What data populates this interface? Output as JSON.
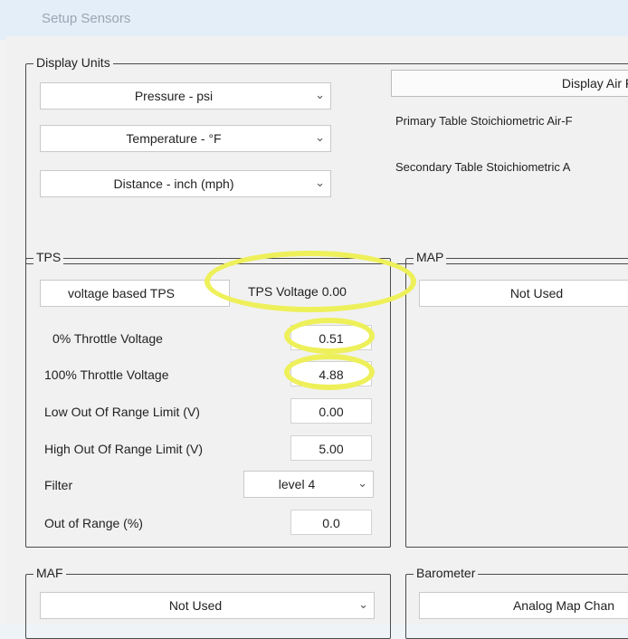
{
  "window": {
    "title": "Setup Sensors"
  },
  "display_units": {
    "legend": "Display Units",
    "pressure": "Pressure - psi",
    "temperature": "Temperature - °F",
    "distance": "Distance - inch (mph)",
    "display_air_fuel_button": "Display Air Fue",
    "primary_table_label": "Primary Table Stoichiometric Air-F",
    "secondary_table_label": "Secondary Table Stoichiometric A"
  },
  "tps": {
    "legend": "TPS",
    "mode": "voltage based TPS",
    "voltage_readout": "TPS Voltage 0.00",
    "rows": [
      {
        "label": "0% Throttle Voltage",
        "value": "0.51"
      },
      {
        "label": "100% Throttle Voltage",
        "value": "4.88"
      },
      {
        "label": "Low Out Of Range Limit (V)",
        "value": "0.00"
      },
      {
        "label": "High Out Of Range Limit (V)",
        "value": "5.00"
      }
    ],
    "filter_label": "Filter",
    "filter_value": "level 4",
    "out_of_range_label": "Out of Range (%)",
    "out_of_range_value": "0.0"
  },
  "map": {
    "legend": "MAP",
    "value": "Not Used"
  },
  "maf": {
    "legend": "MAF",
    "value": "Not Used"
  },
  "barometer": {
    "legend": "Barometer",
    "value": "Analog Map Chan"
  },
  "colors": {
    "highlight": "#eef05a",
    "window_bg": "#f1f1f1"
  }
}
